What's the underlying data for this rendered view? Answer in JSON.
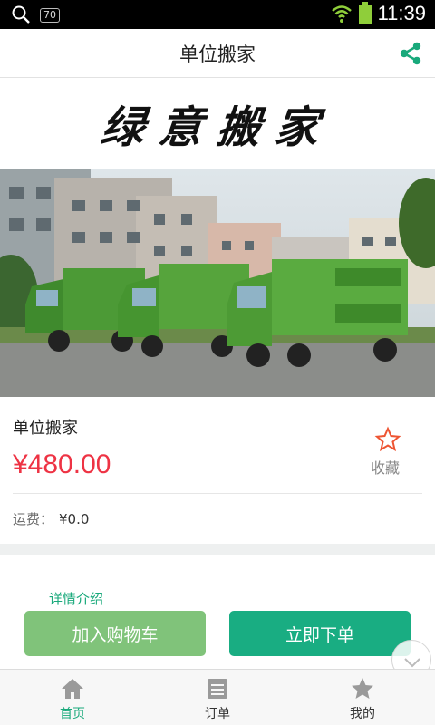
{
  "status_bar": {
    "badge": "70",
    "time": "11:39",
    "icons": [
      "search-icon",
      "wifi-icon",
      "battery-icon"
    ]
  },
  "header": {
    "title": "单位搬家",
    "share_icon": "share-icon"
  },
  "brand": {
    "text": "绿意搬家"
  },
  "product": {
    "name": "单位搬家",
    "price": "¥480.00",
    "favorite_label": "收藏",
    "shipping_label": "运费：",
    "shipping_value": "¥0.0"
  },
  "details": {
    "title": "详情介绍"
  },
  "actions": {
    "add_to_cart": "加入购物车",
    "buy_now": "立即下单"
  },
  "bottom_nav": {
    "items": [
      {
        "label": "首页",
        "icon": "home-icon",
        "active": true
      },
      {
        "label": "订单",
        "icon": "order-icon",
        "active": false
      },
      {
        "label": "我的",
        "icon": "star-icon",
        "active": false
      }
    ]
  },
  "colors": {
    "accent": "#19a97b",
    "price": "#ee3344",
    "cart_button": "#80c37a",
    "buy_button": "#19ad82"
  }
}
